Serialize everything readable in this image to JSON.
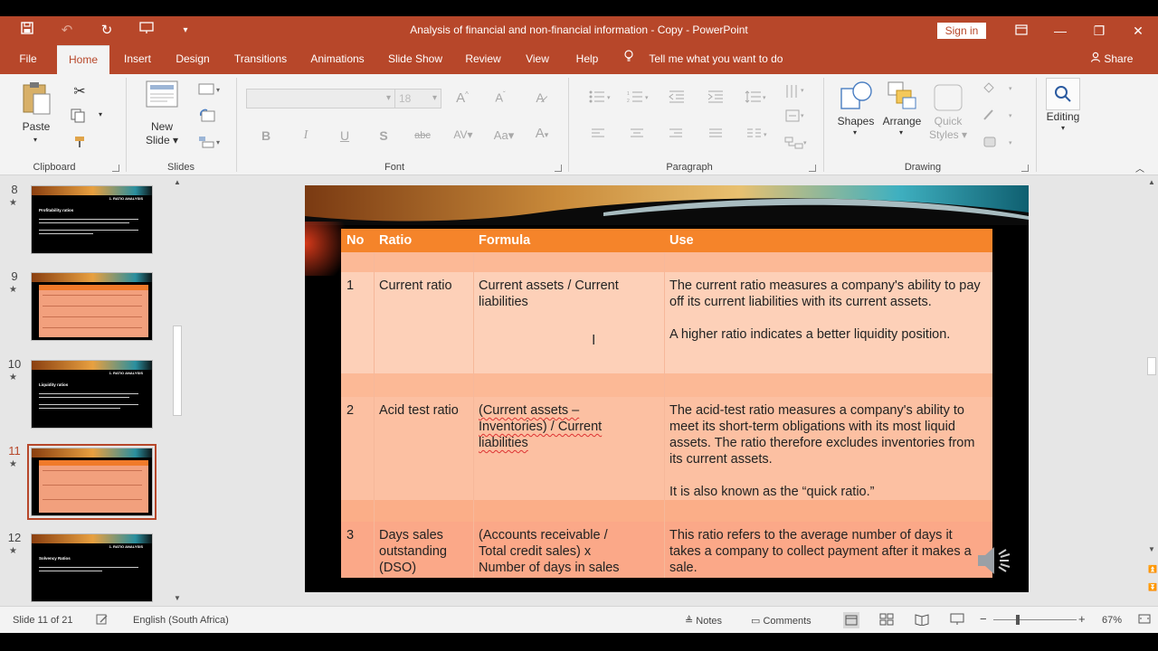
{
  "window": {
    "title": "Analysis of financial and non-financial information - Copy  -  PowerPoint",
    "sign_in": "Sign in",
    "accent": "#b7472a"
  },
  "tabs": [
    "File",
    "Home",
    "Insert",
    "Design",
    "Transitions",
    "Animations",
    "Slide Show",
    "Review",
    "View",
    "Help"
  ],
  "active_tab": "Home",
  "tell_me": "Tell me what you want to do",
  "share": "Share",
  "ribbon": {
    "clipboard": {
      "paste": "Paste",
      "label": "Clipboard"
    },
    "slides": {
      "new_slide_1": "New",
      "new_slide_2": "Slide",
      "label": "Slides"
    },
    "font": {
      "size": "18",
      "label": "Font",
      "bold": "B",
      "italic": "I",
      "underline": "U",
      "shadow": "S",
      "strike": "abc",
      "spacing": "AV",
      "case": "Aa",
      "color": "A"
    },
    "paragraph": {
      "label": "Paragraph"
    },
    "drawing": {
      "shapes": "Shapes",
      "arrange": "Arrange",
      "quick_styles_1": "Quick",
      "quick_styles_2": "Styles",
      "label": "Drawing"
    },
    "editing": {
      "label": "Editing"
    }
  },
  "thumbnails": [
    {
      "num": "8",
      "title": "1. RATIO ANALYSIS",
      "subtitle": "Profitability ratios",
      "style": "text"
    },
    {
      "num": "9",
      "style": "table"
    },
    {
      "num": "10",
      "title": "1. RATIO ANALYSIS",
      "subtitle": "Liquidity ratios",
      "style": "text"
    },
    {
      "num": "11",
      "style": "table",
      "active": true
    },
    {
      "num": "12",
      "title": "1. RATIO ANALYSIS",
      "subtitle": "Solvency Ratios",
      "style": "text"
    }
  ],
  "slide": {
    "headers": {
      "no": "No",
      "ratio": "Ratio",
      "formula": "Formula",
      "use": "Use"
    },
    "rows": [
      {
        "no": "1",
        "ratio": "Current ratio",
        "formula_1": "Current assets / Current",
        "formula_2": "liabilities",
        "use_1": "The current ratio measures a company's ability to pay off its current liabilities with its current assets.",
        "use_2": "A higher ratio indicates a better liquidity position."
      },
      {
        "no": "2",
        "ratio": "Acid test ratio",
        "formula_1": "(Current assets –",
        "formula_2": "Inventories) / Current",
        "formula_3": "liabilities",
        "use_1": "The acid-test ratio measures a company's ability to meet its short-term obligations with its most liquid assets. The ratio therefore excludes inventories from its current assets.",
        "use_2": "It is also known as the “quick ratio.”"
      },
      {
        "no": "3",
        "ratio": "Days sales outstanding (DSO)",
        "formula_1": "(Accounts receivable /",
        "formula_2": "Total credit sales) x",
        "formula_3": "Number of days in sales",
        "use_1": "This ratio refers to the average number of days it takes a company to collect payment after it makes a sale."
      }
    ]
  },
  "status": {
    "slide_info": "Slide 11 of 21",
    "language": "English (South Africa)",
    "notes": "Notes",
    "comments": "Comments",
    "zoom": "67%"
  }
}
